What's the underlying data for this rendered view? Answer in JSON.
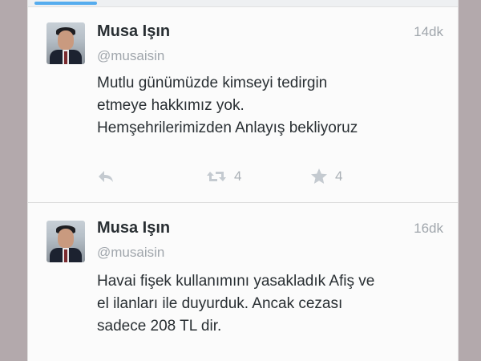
{
  "tweets": [
    {
      "author": {
        "name": "Musa Işın",
        "handle": "@musaisin"
      },
      "time": "14dk",
      "text_lines": [
        "Mutlu günümüzde kimseyi tedirgin",
        "etmeye hakkımız yok.",
        "Hemşehrilerimizden Anlayış bekliyoruz"
      ],
      "actions": {
        "retweets": "4",
        "favorites": "4"
      }
    },
    {
      "author": {
        "name": "Musa Işın",
        "handle": "@musaisin"
      },
      "time": "16dk",
      "text_lines": [
        "Havai fişek kullanımını yasakladık Afiş ve",
        "el ilanları ile duyurduk. Ancak cezası",
        "sadece 208 TL dir."
      ]
    }
  ],
  "icons": [
    "reply-icon",
    "retweet-icon",
    "star-icon"
  ],
  "colors": {
    "accent": "#55acee",
    "text": "#292f33",
    "muted": "#a0a6ac",
    "icon": "#bcc2c8"
  }
}
